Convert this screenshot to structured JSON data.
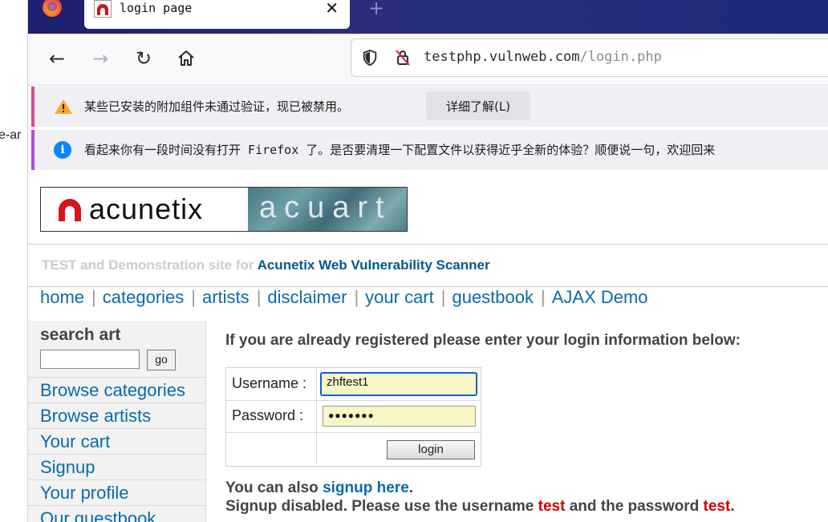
{
  "side_clip_text": "e-ar",
  "browser": {
    "tab_title": "login page",
    "tab_close": "✕",
    "new_tab": "+",
    "url_host": "testphp.vulnweb.com",
    "url_path": "/login.php",
    "nav": {
      "back": "←",
      "forward": "→",
      "reload": "↻"
    }
  },
  "notifications": {
    "addon_warning": "某些已安装的附加组件未通过验证，现已被禁用。",
    "addon_button": "详细了解(L)",
    "refresh_info": "看起来你有一段时间没有打开 Firefox 了。是否要清理一下配置文件以获得近乎全新的体验？顺便说一句，欢迎回来"
  },
  "site": {
    "logo_word": "acunetix",
    "logo_art": "acuart",
    "tagline_prefix": "TEST and Demonstration site for ",
    "tagline_link": "Acunetix Web Vulnerability Scanner",
    "menu": [
      "home",
      "categories",
      "artists",
      "disclaimer",
      "your cart",
      "guestbook",
      "AJAX Demo"
    ],
    "sidebar": {
      "search_title": "search art",
      "search_value": "",
      "go_label": "go",
      "links": [
        "Browse categories",
        "Browse artists",
        "Your cart",
        "Signup",
        "Your profile",
        "Our guestbook"
      ]
    },
    "login": {
      "heading": "If you are already registered please enter your login information below:",
      "username_label": "Username :",
      "username_value": "zhftest1",
      "password_label": "Password :",
      "password_value": "●●●●●●●",
      "login_button": "login",
      "signup_prefix": "You can also ",
      "signup_link": "signup here",
      "signup_suffix": ".",
      "disabled_prefix": "Signup disabled. Please use the username ",
      "disabled_user": "test",
      "disabled_mid": " and the password ",
      "disabled_pass": "test",
      "disabled_suffix": "."
    }
  }
}
